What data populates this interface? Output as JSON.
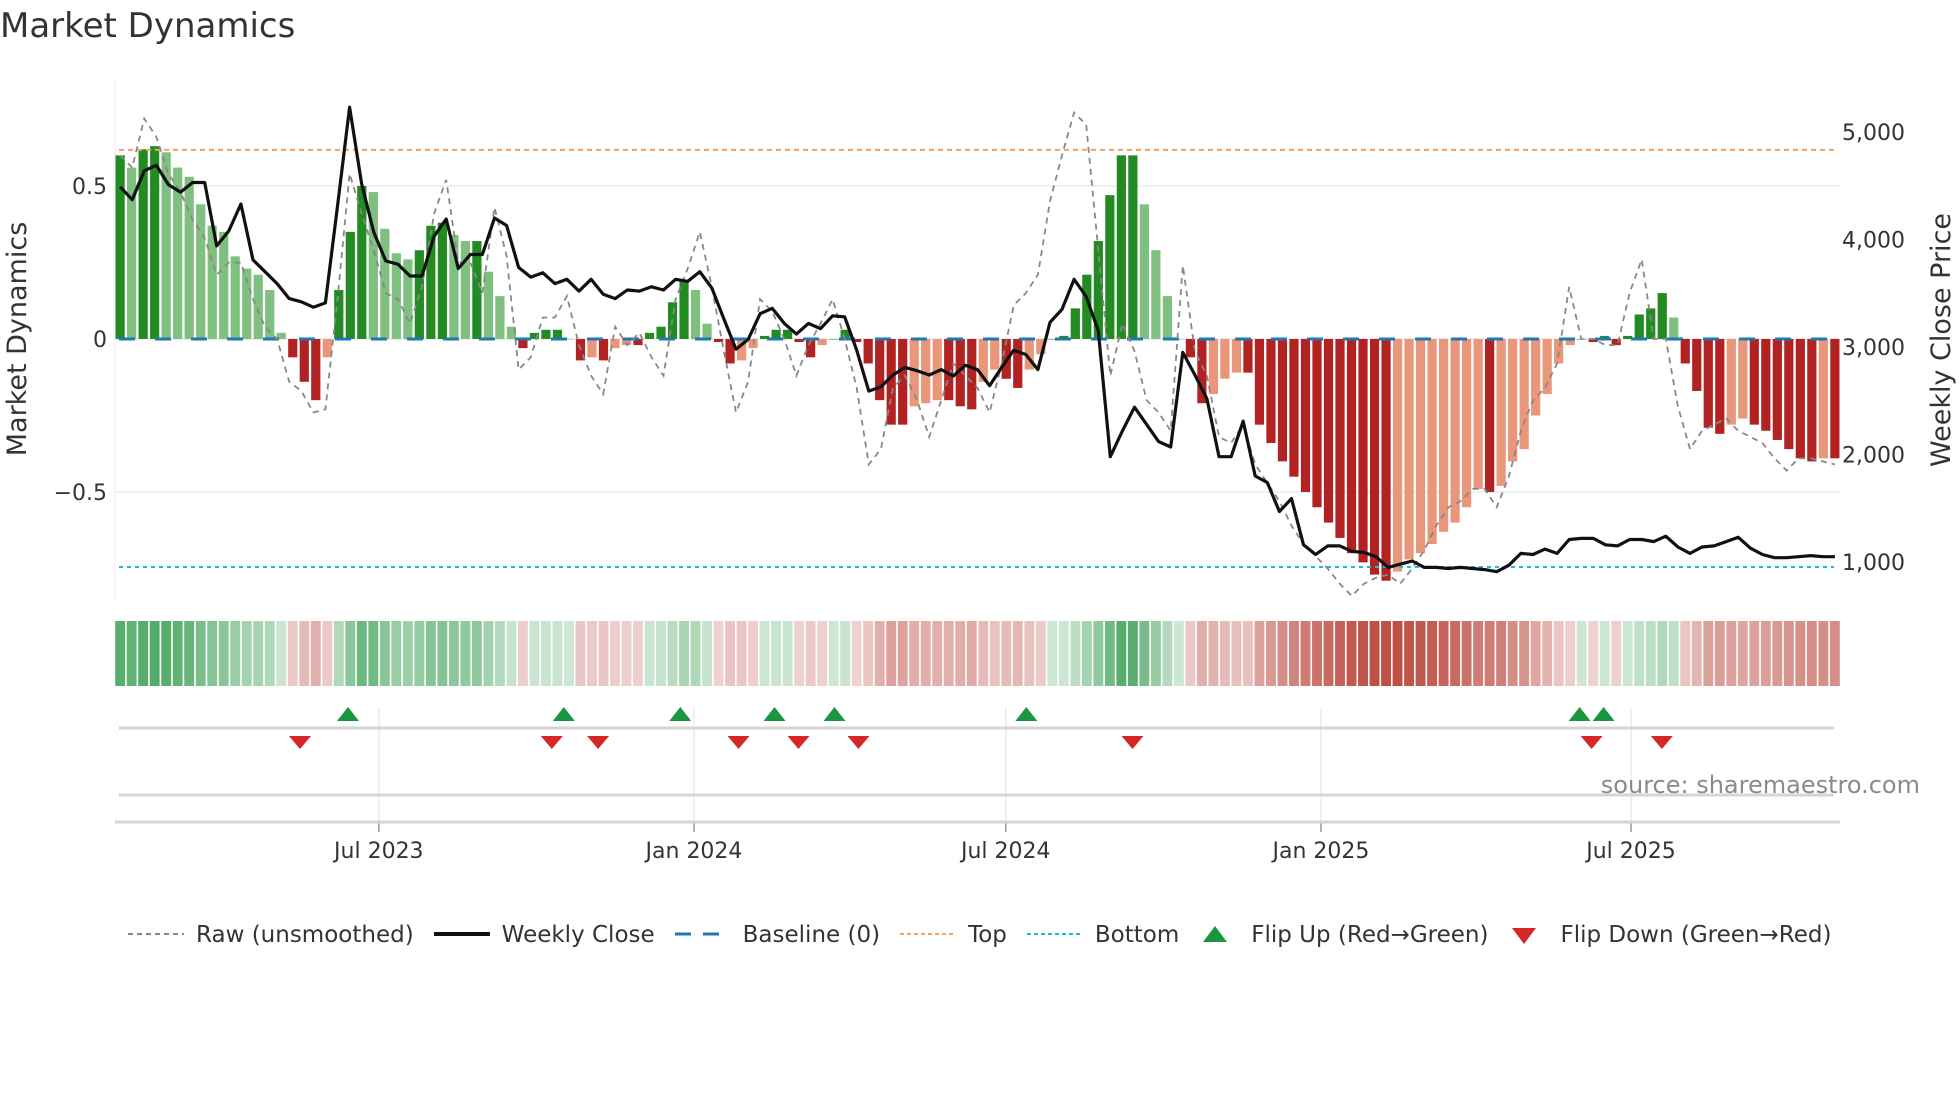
{
  "title": "Market Dynamics",
  "source": "source: sharemaestro.com",
  "chart_data": {
    "type": "bar+line",
    "title": "Market Dynamics",
    "ylabel": "Market Dynamics",
    "y2label": "Weekly Close Price",
    "ylim": [
      -0.853,
      0.843
    ],
    "y2lim": [
      647,
      5474
    ],
    "xlim": [
      "2023-01-28",
      "2025-10-31"
    ],
    "first_week": "2023-01-31",
    "last_week": "2025-10-28",
    "yticks": [
      {
        "v": 0.5,
        "label": "0.5"
      },
      {
        "v": 0,
        "label": "0"
      },
      {
        "v": -0.5,
        "label": "−0.5"
      }
    ],
    "y2ticks": [
      {
        "v": 5000,
        "label": "5,000"
      },
      {
        "v": 4000,
        "label": "4,000"
      },
      {
        "v": 3000,
        "label": "3,000"
      },
      {
        "v": 2000,
        "label": "2,000"
      },
      {
        "v": 1000,
        "label": "1,000"
      }
    ],
    "xticks": [
      {
        "date": "2023-07-01",
        "label": "Jul 2023"
      },
      {
        "date": "2024-01-01",
        "label": "Jan 2024"
      },
      {
        "date": "2024-07-01",
        "label": "Jul 2024"
      },
      {
        "date": "2025-01-01",
        "label": "Jan 2025"
      },
      {
        "date": "2025-07-01",
        "label": "Jul 2025"
      }
    ],
    "top_level": 0.618,
    "bottom_level": -0.745,
    "baseline": 0,
    "colors": {
      "up_strong": "#228B22",
      "up_weak": "#7fbf7f",
      "down_strong": "#b22222",
      "down_weak": "#e9967a",
      "raw": "#888888",
      "close": "#111111",
      "baseline": "#1f77b4",
      "top": "#f4a261",
      "bottom": "#17becf",
      "flip_up": "#1a9641",
      "flip_down": "#d62728"
    },
    "dynamics": [
      0.6,
      0.56,
      0.62,
      0.63,
      0.61,
      0.56,
      0.53,
      0.44,
      0.37,
      0.35,
      0.27,
      0.23,
      0.21,
      0.16,
      0.02,
      -0.06,
      -0.14,
      -0.2,
      -0.06,
      0.16,
      0.35,
      0.5,
      0.48,
      0.36,
      0.28,
      0.26,
      0.29,
      0.37,
      0.38,
      0.34,
      0.32,
      0.32,
      0.22,
      0.14,
      0.04,
      -0.03,
      0.02,
      0.03,
      0.03,
      0.0,
      -0.07,
      -0.06,
      -0.07,
      -0.03,
      -0.02,
      -0.02,
      0.02,
      0.04,
      0.12,
      0.19,
      0.16,
      0.05,
      -0.01,
      -0.08,
      -0.07,
      -0.03,
      0.01,
      0.03,
      0.03,
      -0.01,
      -0.06,
      -0.02,
      0.0,
      0.03,
      -0.01,
      -0.08,
      -0.2,
      -0.28,
      -0.28,
      -0.22,
      -0.21,
      -0.2,
      -0.2,
      -0.22,
      -0.23,
      -0.14,
      -0.1,
      -0.13,
      -0.16,
      -0.1,
      -0.05,
      0.0,
      0.01,
      0.1,
      0.21,
      0.32,
      0.47,
      0.6,
      0.6,
      0.44,
      0.29,
      0.14,
      0.0,
      -0.06,
      -0.21,
      -0.18,
      -0.13,
      -0.11,
      -0.11,
      -0.28,
      -0.34,
      -0.4,
      -0.45,
      -0.5,
      -0.55,
      -0.6,
      -0.65,
      -0.7,
      -0.73,
      -0.77,
      -0.79,
      -0.76,
      -0.72,
      -0.7,
      -0.67,
      -0.63,
      -0.6,
      -0.55,
      -0.49,
      -0.5,
      -0.48,
      -0.4,
      -0.36,
      -0.25,
      -0.18,
      -0.08,
      -0.02,
      0.0,
      -0.01,
      0.01,
      -0.02,
      0.01,
      0.08,
      0.1,
      0.15,
      0.07,
      -0.08,
      -0.17,
      -0.29,
      -0.31,
      -0.28,
      -0.26,
      -0.28,
      -0.3,
      -0.33,
      -0.36,
      -0.39,
      -0.4,
      -0.39,
      -0.39
    ],
    "raw": [
      0.6,
      0.56,
      0.72,
      0.66,
      0.54,
      0.48,
      0.39,
      0.33,
      0.21,
      0.25,
      0.25,
      0.13,
      0.04,
      0.0,
      -0.14,
      -0.17,
      -0.24,
      -0.23,
      0.13,
      0.54,
      0.41,
      0.29,
      0.15,
      0.13,
      0.05,
      0.17,
      0.41,
      0.52,
      0.25,
      0.25,
      0.15,
      0.43,
      0.27,
      -0.1,
      -0.06,
      0.07,
      0.07,
      0.14,
      -0.02,
      -0.12,
      -0.18,
      0.04,
      -0.02,
      0.02,
      -0.06,
      -0.12,
      0.13,
      0.23,
      0.35,
      0.17,
      -0.04,
      -0.24,
      -0.14,
      0.13,
      0.09,
      0.0,
      -0.12,
      -0.02,
      0.05,
      0.13,
      0.0,
      -0.16,
      -0.41,
      -0.36,
      -0.16,
      -0.12,
      -0.2,
      -0.32,
      -0.2,
      -0.08,
      -0.12,
      -0.16,
      -0.24,
      -0.08,
      0.11,
      0.15,
      0.21,
      0.45,
      0.6,
      0.74,
      0.7,
      0.29,
      -0.12,
      0.05,
      -0.04,
      -0.2,
      -0.24,
      -0.3,
      0.24,
      -0.04,
      -0.12,
      -0.32,
      -0.34,
      -0.28,
      -0.41,
      -0.47,
      -0.53,
      -0.61,
      -0.67,
      -0.71,
      -0.75,
      -0.8,
      -0.84,
      -0.8,
      -0.78,
      -0.77,
      -0.8,
      -0.75,
      -0.69,
      -0.61,
      -0.55,
      -0.53,
      -0.49,
      -0.49,
      -0.55,
      -0.45,
      -0.3,
      -0.2,
      -0.16,
      -0.08,
      0.17,
      0.0,
      0.0,
      -0.02,
      -0.02,
      0.15,
      0.26,
      0.0,
      0.0,
      -0.22,
      -0.36,
      -0.3,
      -0.28,
      -0.26,
      -0.3,
      -0.32,
      -0.34,
      -0.39,
      -0.43,
      -0.39,
      -0.39,
      -0.4,
      -0.41
    ],
    "close": [
      4490,
      4370,
      4640,
      4690,
      4510,
      4440,
      4530,
      4530,
      3940,
      4080,
      4330,
      3810,
      3700,
      3590,
      3450,
      3420,
      3370,
      3410,
      4310,
      5230,
      4520,
      4070,
      3800,
      3770,
      3660,
      3660,
      4030,
      4190,
      3730,
      3860,
      3860,
      4200,
      4130,
      3740,
      3650,
      3690,
      3590,
      3630,
      3520,
      3630,
      3490,
      3450,
      3530,
      3520,
      3560,
      3530,
      3630,
      3610,
      3700,
      3550,
      3260,
      2980,
      3070,
      3310,
      3360,
      3220,
      3120,
      3220,
      3170,
      3290,
      3280,
      2970,
      2590,
      2630,
      2740,
      2810,
      2780,
      2740,
      2790,
      2730,
      2830,
      2790,
      2640,
      2810,
      2970,
      2930,
      2790,
      3230,
      3350,
      3630,
      3470,
      3150,
      1980,
      2220,
      2440,
      2280,
      2120,
      2070,
      2950,
      2740,
      2520,
      1980,
      1980,
      2310,
      1800,
      1740,
      1470,
      1590,
      1160,
      1070,
      1150,
      1150,
      1100,
      1090,
      1050,
      950,
      980,
      1010,
      950,
      950,
      940,
      950,
      940,
      930,
      910,
      970,
      1080,
      1070,
      1120,
      1080,
      1210,
      1220,
      1220,
      1160,
      1150,
      1210,
      1210,
      1190,
      1240,
      1140,
      1080,
      1140,
      1150,
      1190,
      1230,
      1130,
      1070,
      1040,
      1040,
      1050,
      1060,
      1050,
      1050
    ],
    "flip_up": [
      "2023-06-13",
      "2023-10-17",
      "2023-12-24",
      "2024-02-17",
      "2024-03-23",
      "2024-07-13",
      "2025-06-01",
      "2025-06-15"
    ],
    "flip_down": [
      "2023-05-16",
      "2023-10-10",
      "2023-11-06",
      "2024-01-27",
      "2024-03-02",
      "2024-04-06",
      "2024-09-13",
      "2025-06-08",
      "2025-07-19"
    ],
    "legend": [
      {
        "key": "raw",
        "label": "Raw (unsmoothed)"
      },
      {
        "key": "close",
        "label": "Weekly Close"
      },
      {
        "key": "baseline",
        "label": "Baseline (0)"
      },
      {
        "key": "top",
        "label": "Top"
      },
      {
        "key": "bottom",
        "label": "Bottom"
      },
      {
        "key": "flip_up",
        "label": "Flip Up (Red→Green)"
      },
      {
        "key": "flip_down",
        "label": "Flip Down (Green→Red)"
      }
    ],
    "legend_position": "bottom"
  }
}
